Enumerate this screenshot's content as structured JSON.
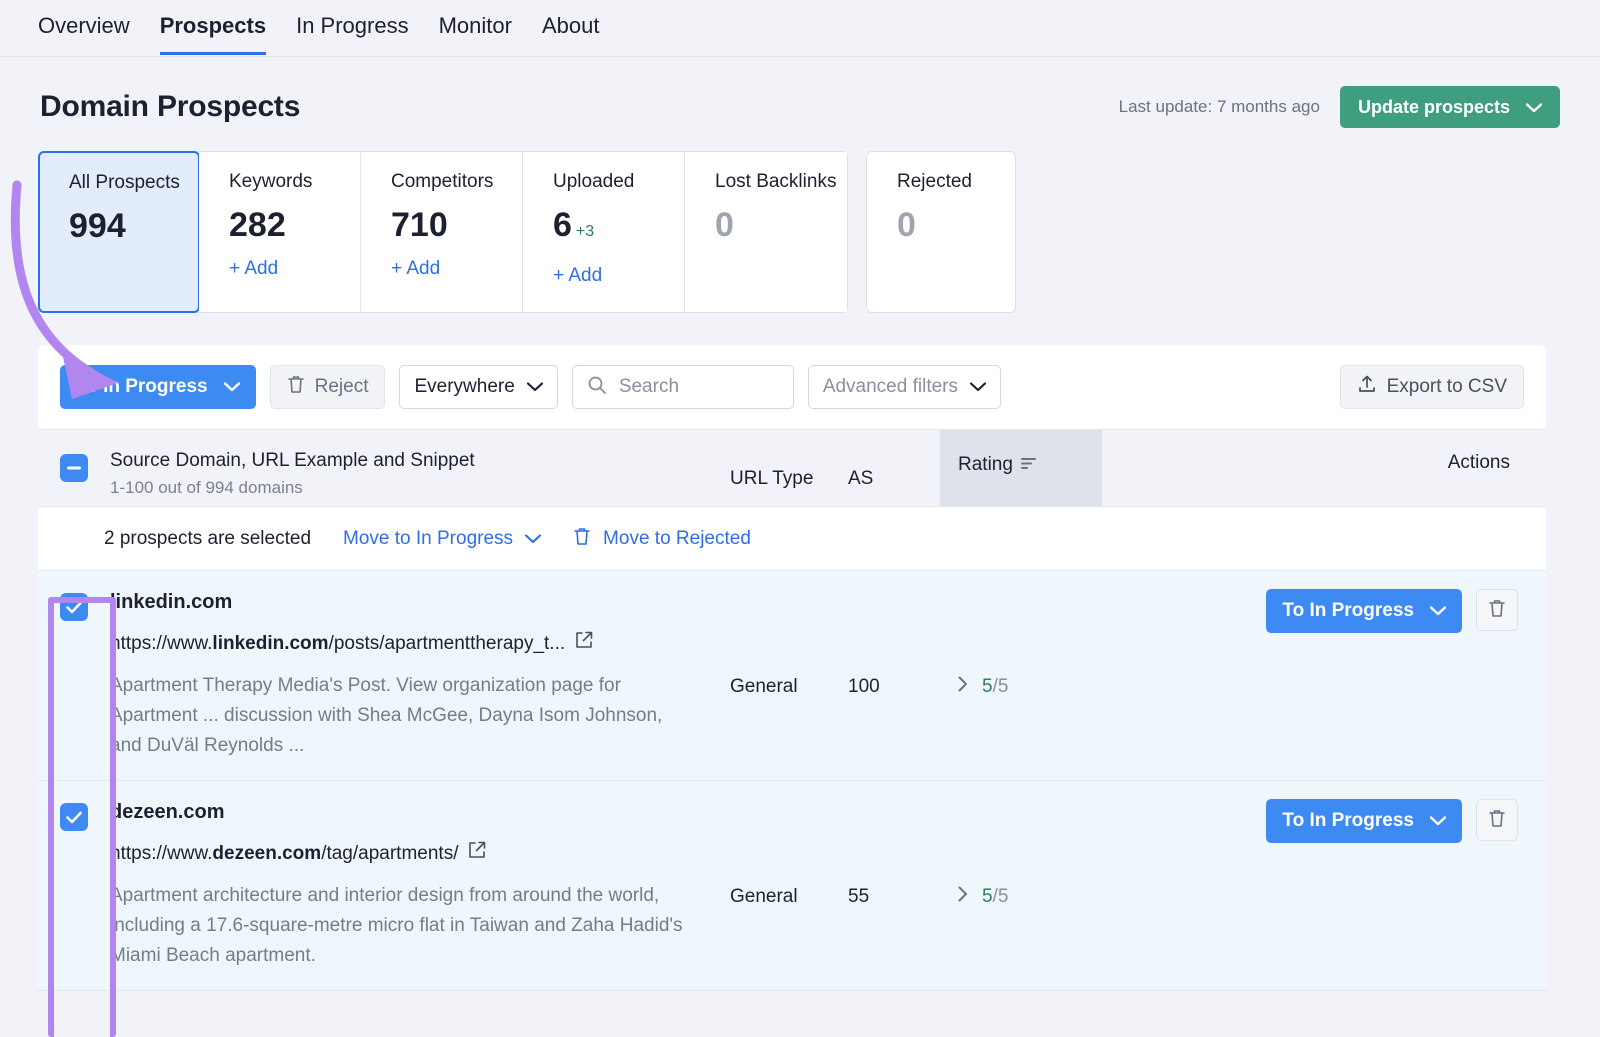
{
  "nav": {
    "tabs": [
      {
        "label": "Overview",
        "active": false
      },
      {
        "label": "Prospects",
        "active": true
      },
      {
        "label": "In Progress",
        "active": false
      },
      {
        "label": "Monitor",
        "active": false
      },
      {
        "label": "About",
        "active": false
      }
    ]
  },
  "header": {
    "title": "Domain Prospects",
    "last_update": "Last update: 7 months ago",
    "update_button": "Update prospects",
    "update_button_color": "#3f9e80"
  },
  "cards": [
    {
      "label": "All Prospects",
      "value": "994",
      "add": "",
      "delta": "",
      "active": true
    },
    {
      "label": "Keywords",
      "value": "282",
      "add": "+ Add",
      "delta": "",
      "active": false
    },
    {
      "label": "Competitors",
      "value": "710",
      "add": "+ Add",
      "delta": "",
      "active": false
    },
    {
      "label": "Uploaded",
      "value": "6",
      "add": "+ Add",
      "delta": "+3",
      "active": false
    },
    {
      "label": "Lost Backlinks",
      "value": "0",
      "add": "",
      "delta": "",
      "active": false
    }
  ],
  "card_standalone": {
    "label": "Rejected",
    "value": "0"
  },
  "toolbar": {
    "to_in_progress": "To In Progress",
    "reject": "Reject",
    "scope": "Everywhere",
    "search_placeholder": "Search",
    "search_value": "",
    "advanced_filters": "Advanced filters",
    "export": "Export to CSV"
  },
  "table": {
    "headers": {
      "source": "Source Domain, URL Example and Snippet",
      "source_sub": "1-100 out of 994 domains",
      "url_type": "URL Type",
      "as": "AS",
      "rating": "Rating",
      "actions": "Actions"
    },
    "selection_bar": {
      "count_text": "2 prospects are selected",
      "move_in_progress": "Move to In Progress",
      "move_rejected": "Move to Rejected"
    },
    "rows": [
      {
        "checked": true,
        "domain": "linkedin.com",
        "url_prefix": "https://www.",
        "url_domain": "linkedin.com",
        "url_suffix": "/posts/apartmenttherapy_t...",
        "snippet": "Apartment Therapy Media's Post. View organization page for Apartment ... discussion with Shea McGee, Dayna Isom Johnson, and DuVäl Reynolds ...",
        "url_type": "General",
        "as": "100",
        "rating_score": "5",
        "rating_max": "/5",
        "action_label": "To In Progress"
      },
      {
        "checked": true,
        "domain": "dezeen.com",
        "url_prefix": "https://www.",
        "url_domain": "dezeen.com",
        "url_suffix": "/tag/apartments/",
        "snippet": "Apartment architecture and interior design from around the world, including a 17.6-square-metre micro flat in Taiwan and Zaha Hadid's Miami Beach apartment.",
        "url_type": "General",
        "as": "55",
        "rating_score": "5",
        "rating_max": "/5",
        "action_label": "To In Progress"
      }
    ]
  },
  "annotations": {
    "arrow_color": "#b286ef",
    "rect_color": "#b286ef"
  }
}
